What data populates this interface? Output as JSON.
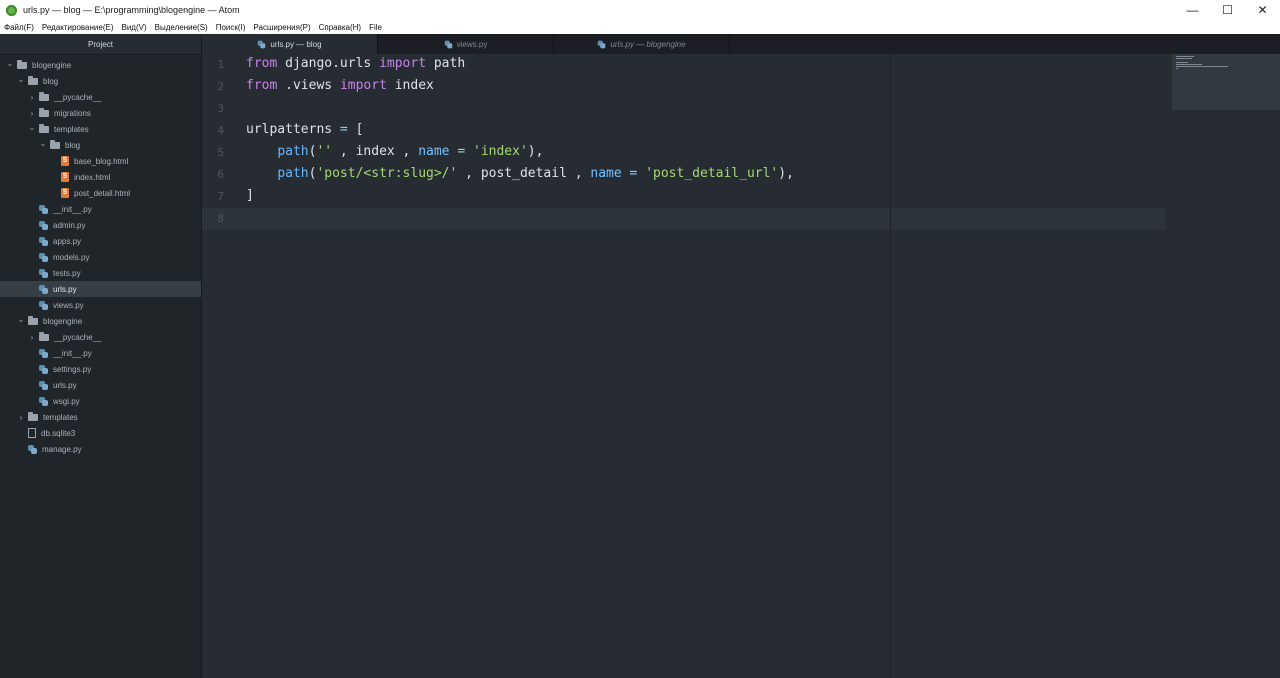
{
  "window": {
    "title": "urls.py — blog — E:\\programming\\blogengine — Atom",
    "controls": {
      "minimize": "—",
      "maximize": "☐",
      "close": "✕"
    }
  },
  "menu": [
    "Файл(F)",
    "Редактирование(E)",
    "Вид(V)",
    "Выделение(S)",
    "Поиск(I)",
    "Расширения(P)",
    "Справка(H)",
    "File"
  ],
  "sidebar": {
    "title": "Project",
    "tree": [
      {
        "label": "blogengine",
        "type": "folder",
        "depth": 0,
        "expanded": true
      },
      {
        "label": "blog",
        "type": "folder",
        "depth": 1,
        "expanded": true
      },
      {
        "label": "__pycache__",
        "type": "folder",
        "depth": 2,
        "expanded": false
      },
      {
        "label": "migrations",
        "type": "folder",
        "depth": 2,
        "expanded": false
      },
      {
        "label": "templates",
        "type": "folder",
        "depth": 2,
        "expanded": true
      },
      {
        "label": "blog",
        "type": "folder",
        "depth": 3,
        "expanded": true
      },
      {
        "label": "base_blog.html",
        "type": "html",
        "depth": 4
      },
      {
        "label": "index.html",
        "type": "html",
        "depth": 4
      },
      {
        "label": "post_detail.html",
        "type": "html",
        "depth": 4
      },
      {
        "label": "__init__.py",
        "type": "py",
        "depth": 2
      },
      {
        "label": "admin.py",
        "type": "py",
        "depth": 2
      },
      {
        "label": "apps.py",
        "type": "py",
        "depth": 2
      },
      {
        "label": "models.py",
        "type": "py",
        "depth": 2
      },
      {
        "label": "tests.py",
        "type": "py",
        "depth": 2
      },
      {
        "label": "urls.py",
        "type": "py",
        "depth": 2,
        "selected": true
      },
      {
        "label": "views.py",
        "type": "py",
        "depth": 2
      },
      {
        "label": "blogengine",
        "type": "folder",
        "depth": 1,
        "expanded": true
      },
      {
        "label": "__pycache__",
        "type": "folder",
        "depth": 2,
        "expanded": false
      },
      {
        "label": "__init__.py",
        "type": "py",
        "depth": 2
      },
      {
        "label": "settings.py",
        "type": "py",
        "depth": 2
      },
      {
        "label": "urls.py",
        "type": "py",
        "depth": 2
      },
      {
        "label": "wsgi.py",
        "type": "py",
        "depth": 2
      },
      {
        "label": "templates",
        "type": "folder",
        "depth": 1,
        "expanded": false
      },
      {
        "label": "db.sqlite3",
        "type": "file",
        "depth": 1
      },
      {
        "label": "manage.py",
        "type": "py",
        "depth": 1
      }
    ]
  },
  "tabs": [
    {
      "label": "urls.py — blog",
      "active": true
    },
    {
      "label": "views.py",
      "active": false
    },
    {
      "label": "urls.py — blogengine",
      "active": false,
      "italic": true
    }
  ],
  "editor": {
    "line_numbers": [
      "1",
      "2",
      "3",
      "4",
      "5",
      "6",
      "7",
      "8"
    ],
    "lines": [
      [
        {
          "t": "from",
          "c": "kw"
        },
        {
          "t": " django.urls ",
          "c": ""
        },
        {
          "t": "import",
          "c": "kw"
        },
        {
          "t": " path",
          "c": ""
        }
      ],
      [
        {
          "t": "from",
          "c": "kw"
        },
        {
          "t": " .views ",
          "c": ""
        },
        {
          "t": "import",
          "c": "kw"
        },
        {
          "t": " index",
          "c": ""
        }
      ],
      [],
      [
        {
          "t": "urlpatterns ",
          "c": ""
        },
        {
          "t": "=",
          "c": "op"
        },
        {
          "t": " [",
          "c": ""
        }
      ],
      [
        {
          "t": "    ",
          "c": ""
        },
        {
          "t": "path",
          "c": "fn"
        },
        {
          "t": "(",
          "c": ""
        },
        {
          "t": "''",
          "c": "str"
        },
        {
          "t": " , index , ",
          "c": ""
        },
        {
          "t": "name",
          "c": "attr"
        },
        {
          "t": " ",
          "c": ""
        },
        {
          "t": "=",
          "c": "op"
        },
        {
          "t": " ",
          "c": ""
        },
        {
          "t": "'index'",
          "c": "str"
        },
        {
          "t": "),",
          "c": ""
        }
      ],
      [
        {
          "t": "    ",
          "c": ""
        },
        {
          "t": "path",
          "c": "fn"
        },
        {
          "t": "(",
          "c": ""
        },
        {
          "t": "'post/<str:slug>/'",
          "c": "str"
        },
        {
          "t": " , post_detail , ",
          "c": ""
        },
        {
          "t": "name",
          "c": "attr"
        },
        {
          "t": " ",
          "c": ""
        },
        {
          "t": "=",
          "c": "op"
        },
        {
          "t": " ",
          "c": ""
        },
        {
          "t": "'post_detail_url'",
          "c": "str"
        },
        {
          "t": "),",
          "c": ""
        }
      ],
      [
        {
          "t": "]",
          "c": ""
        }
      ],
      []
    ],
    "cursor_line": 8
  },
  "colors": {
    "keyword": "#c584e8",
    "function": "#66b6ff",
    "string": "#a3d873",
    "editor_bg": "#262c32",
    "sidebar_bg": "#20252a"
  }
}
